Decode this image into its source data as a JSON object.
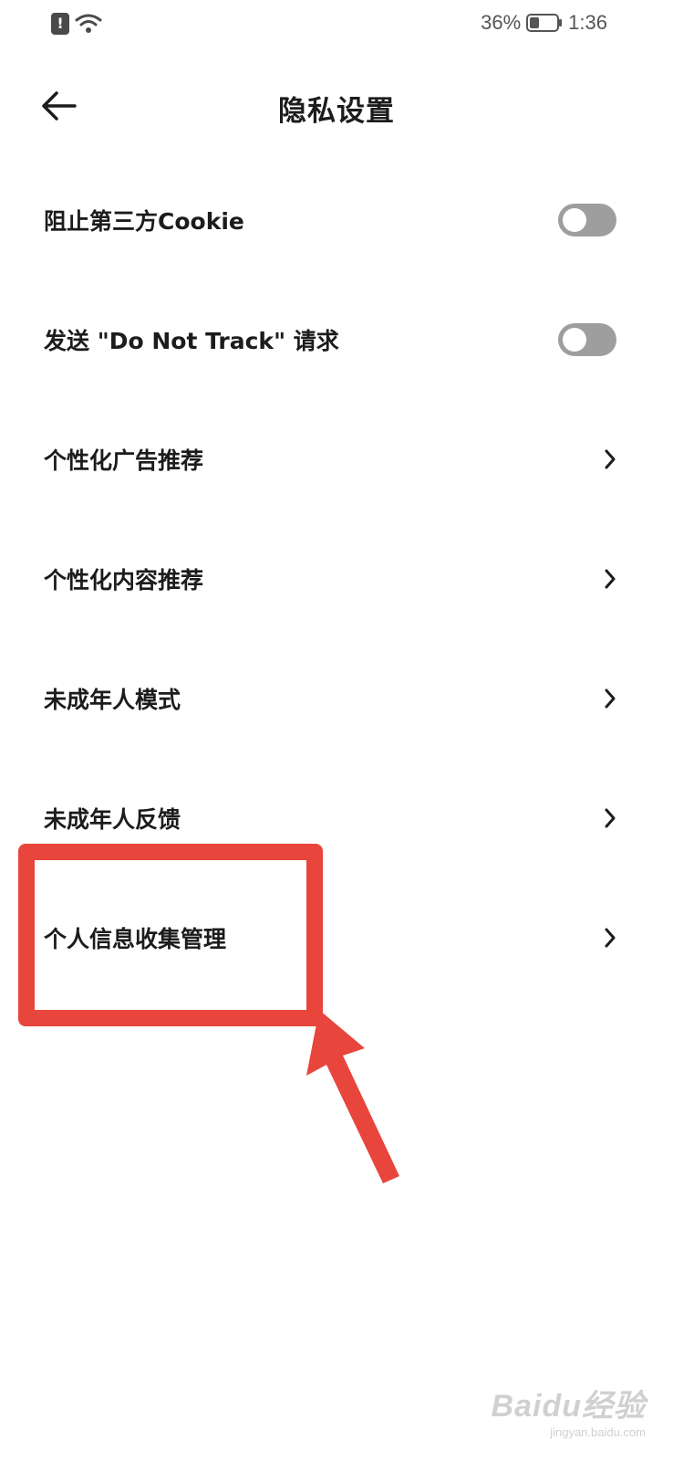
{
  "status_bar": {
    "alert_icon": "alert-icon",
    "alert_glyph": "!",
    "wifi_icon": "wifi-icon",
    "battery_percent": "36%",
    "battery_icon": "battery-icon",
    "time": "1:36"
  },
  "header": {
    "back_icon": "arrow-left-icon",
    "title": "隐私设置"
  },
  "settings": {
    "items": [
      {
        "label": "阻止第三方Cookie",
        "control": "toggle",
        "on": false
      },
      {
        "label": "发送 \"Do Not Track\" 请求",
        "control": "toggle",
        "on": false
      },
      {
        "label": "个性化广告推荐",
        "control": "chevron"
      },
      {
        "label": "个性化内容推荐",
        "control": "chevron"
      },
      {
        "label": "未成年人模式",
        "control": "chevron"
      },
      {
        "label": "未成年人反馈",
        "control": "chevron"
      },
      {
        "label": "个人信息收集管理",
        "control": "chevron"
      }
    ]
  },
  "annotation": {
    "color": "#e8453c",
    "highlight_icon": "highlight-box",
    "arrow_icon": "arrow-up-left-icon"
  },
  "watermark": {
    "logo": "Baidu经验",
    "url": "jingyan.baidu.com"
  },
  "colors": {
    "toggle_off": "#9e9e9e",
    "text_primary": "#1c1c1c",
    "status_text": "#555555"
  }
}
